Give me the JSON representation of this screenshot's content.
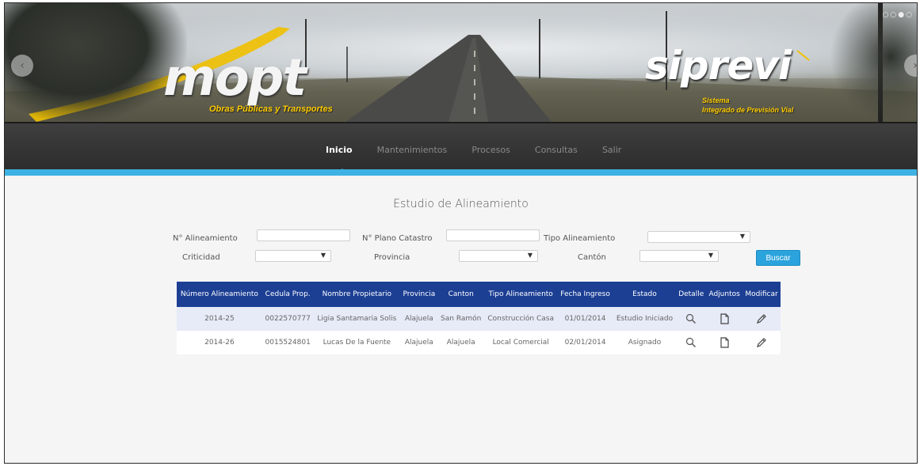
{
  "banner": {
    "logo_left": "mopt",
    "logo_left_sub": "Obras Públicas y Transportes",
    "logo_right": "siprevi",
    "logo_right_sub1": "Sistema",
    "logo_right_sub2": "Integrado de Previsión Vial"
  },
  "nav": {
    "items": [
      {
        "label": "Inicio"
      },
      {
        "label": "Mantenimientos"
      },
      {
        "label": "Procesos"
      },
      {
        "label": "Consultas"
      },
      {
        "label": "Salir"
      }
    ],
    "active": "Inicio",
    "accent_color": "#3db2e3"
  },
  "page_title": "Estudio de Alineamiento",
  "form": {
    "numero_alineamiento": {
      "label": "N° Alineamiento",
      "value": ""
    },
    "plano_catastro": {
      "label": "N° Plano Catastro",
      "value": ""
    },
    "tipo_alineamiento": {
      "label": "Tipo Alineamiento",
      "value": ""
    },
    "criticidad": {
      "label": "Criticidad",
      "value": ""
    },
    "provincia": {
      "label": "Provincia",
      "value": ""
    },
    "canton": {
      "label": "Cantón",
      "value": ""
    },
    "search_label": "Buscar",
    "search_color": "#2ba3dc"
  },
  "table": {
    "header_color": "#1c3f94",
    "columns": [
      "Número Alineamiento",
      "Cedula Prop.",
      "Nombre Propietario",
      "Provincia",
      "Canton",
      "Tipo Alineamiento",
      "Fecha Ingreso",
      "Estado",
      "Detalle",
      "Adjuntos",
      "Modificar"
    ],
    "rows": [
      {
        "numero": "2014-25",
        "cedula": "0022570777",
        "nombre": "Ligia Santamaria Solis",
        "provincia": "Alajuela",
        "canton": "San Ramón",
        "tipo": "Construcción Casa",
        "fecha": "01/01/2014",
        "estado": "Estudio Iniciado"
      },
      {
        "numero": "2014-26",
        "cedula": "0015524801",
        "nombre": "Lucas De la Fuente",
        "provincia": "Alajuela",
        "canton": "Alajuela",
        "tipo": "Local Comercial",
        "fecha": "02/01/2014",
        "estado": "Asignado"
      }
    ],
    "row_icons": [
      "search-icon",
      "document-icon",
      "pencil-icon"
    ]
  }
}
